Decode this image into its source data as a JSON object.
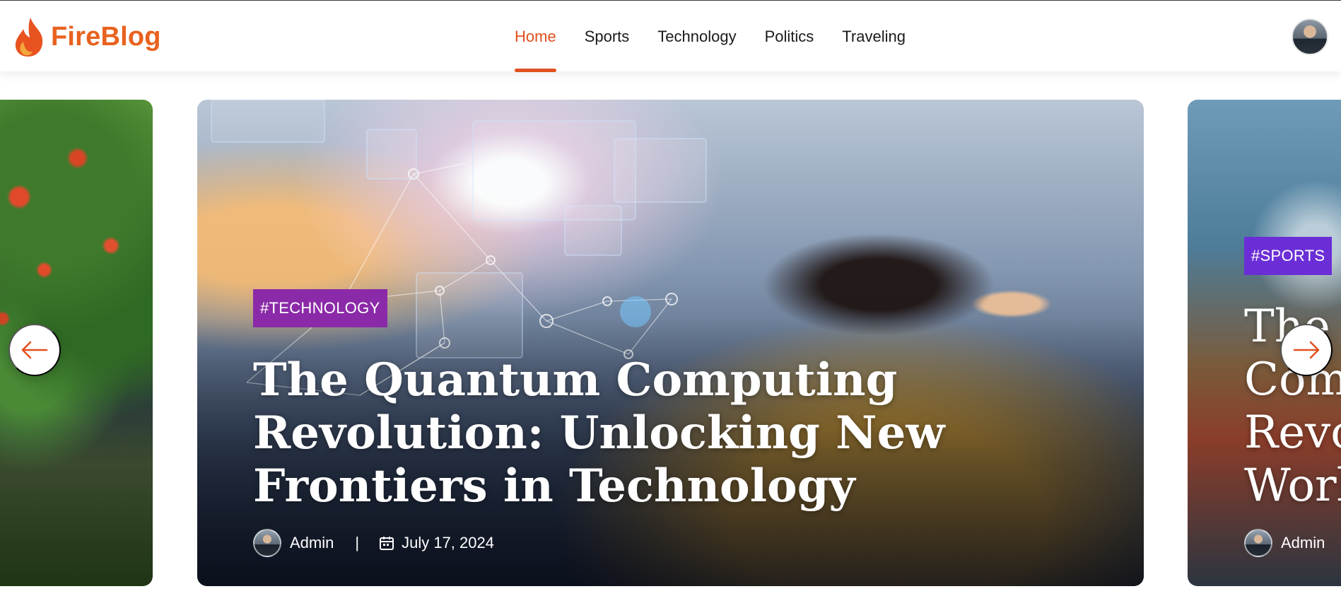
{
  "brand": {
    "name": "FireBlog",
    "logo_icon": "flame-icon"
  },
  "nav": {
    "items": [
      {
        "label": "Home",
        "active": true
      },
      {
        "label": "Sports",
        "active": false
      },
      {
        "label": "Technology",
        "active": false
      },
      {
        "label": "Politics",
        "active": false
      },
      {
        "label": "Traveling",
        "active": false
      }
    ]
  },
  "colors": {
    "accent": "#e1501f",
    "tag_technology": "#8b2aa8",
    "tag_sports": "#6b2ed6"
  },
  "carousel": {
    "prev_icon": "arrow-left-icon",
    "next_icon": "arrow-right-icon",
    "current": {
      "tag": "#TECHNOLOGY",
      "title": "The Quantum Computing Revolution: Unlocking New Frontiers in Technology",
      "author": "Admin",
      "separator": "|",
      "date": "July 17, 2024"
    },
    "next": {
      "tag": "#SPORTS",
      "title_lines": [
        "The",
        "Com",
        "Revo",
        "Work"
      ],
      "author": "Admin"
    }
  }
}
